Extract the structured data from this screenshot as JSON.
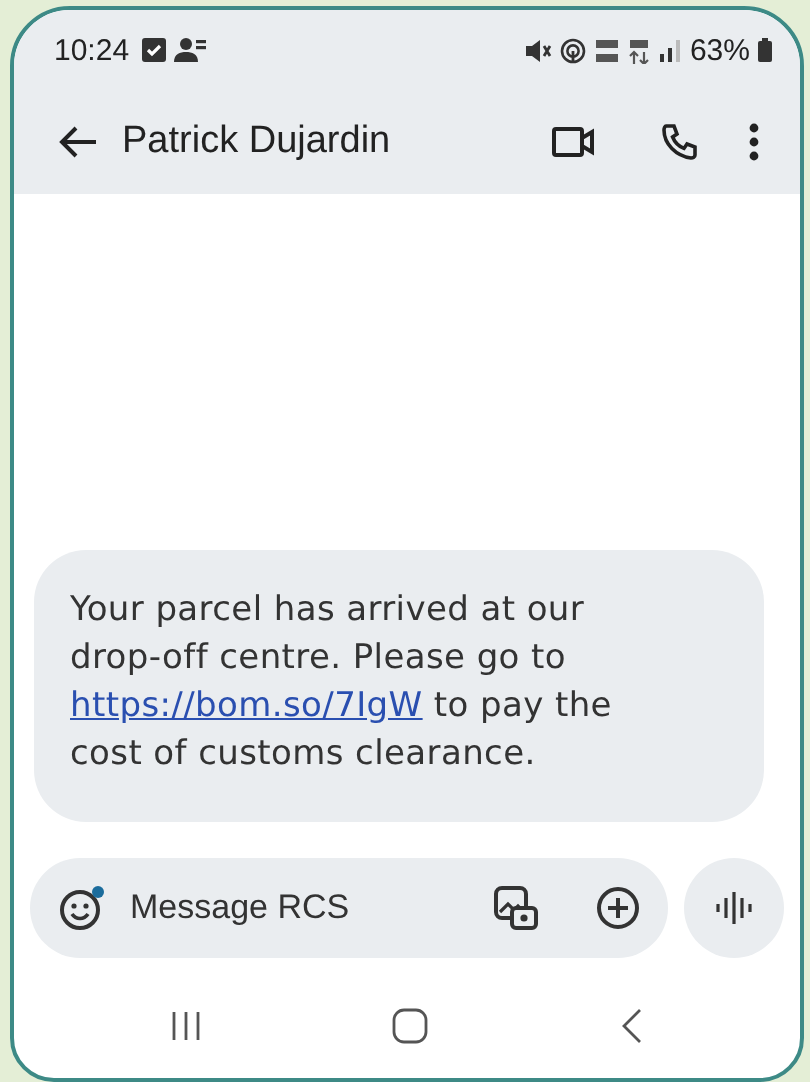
{
  "status_bar": {
    "time": "10:24",
    "battery": "63%"
  },
  "header": {
    "title": "Patrick Dujardin"
  },
  "message": {
    "before": "Your parcel has arrived at our drop-off centre. Please go to ",
    "link": "https://bom.so/7IgW",
    "after": " to pay the cost of customs clearance."
  },
  "composer": {
    "placeholder": "Message RCS",
    "emoji_badge": true
  }
}
